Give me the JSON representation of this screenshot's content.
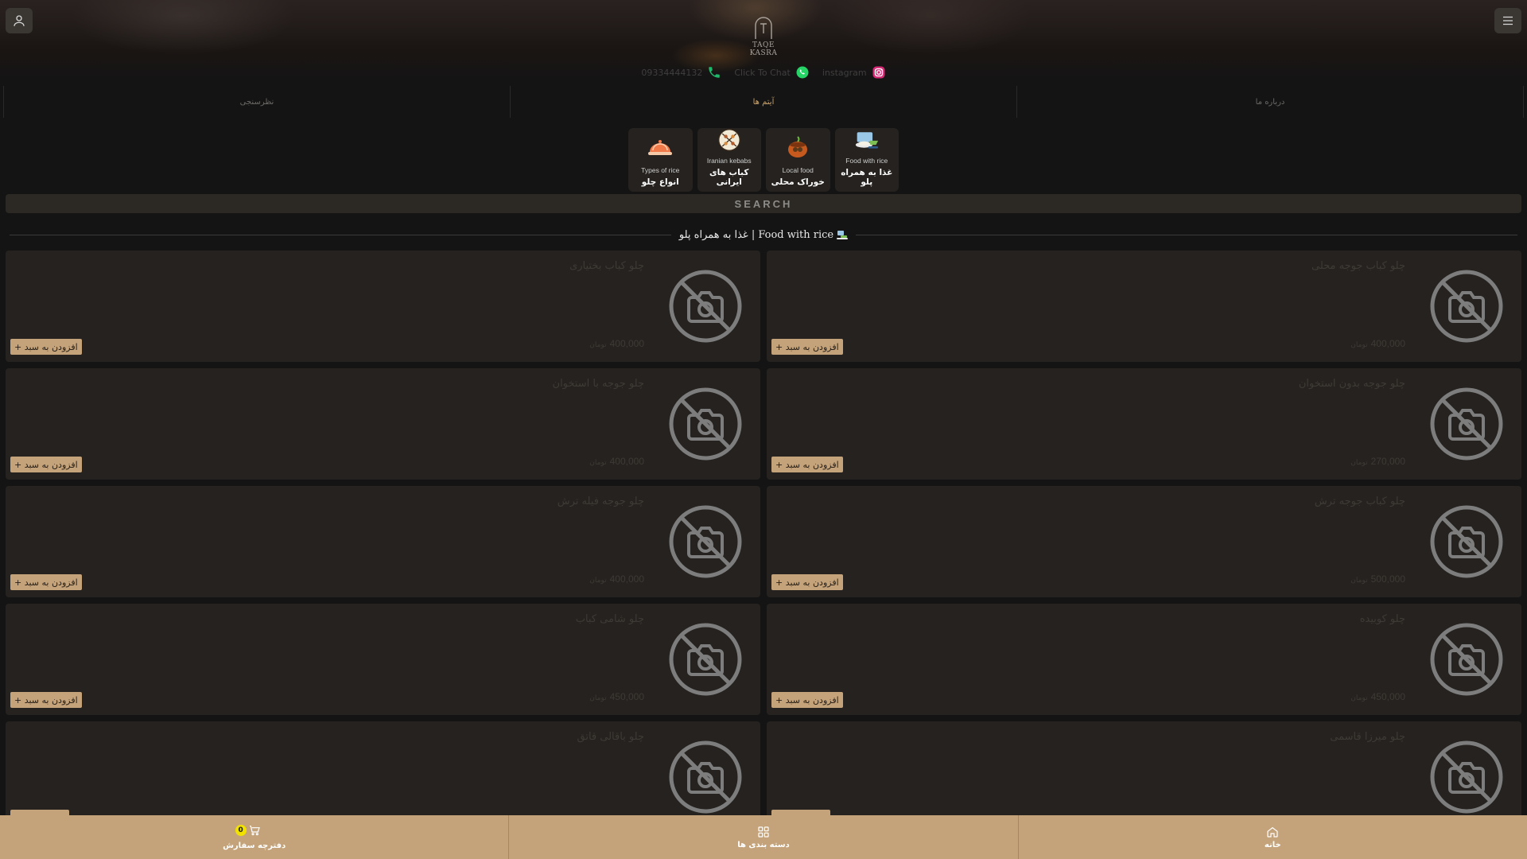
{
  "brand": {
    "name": "TAQE KASRA"
  },
  "contacts": {
    "phone": "09334444132",
    "chat": "Click To Chat",
    "instagram": "instagram"
  },
  "top_tabs": [
    {
      "label": "نظرسنجی",
      "active": false
    },
    {
      "label": "آیتم ها",
      "active": true
    },
    {
      "label": "درباره ما",
      "active": false
    }
  ],
  "categories": [
    {
      "en": "Food with rice",
      "fa": "غذا به همراه پلو",
      "icon": "plate-with-rice-icon"
    },
    {
      "en": "Local food",
      "fa": "خوراک محلی",
      "icon": "clay-pot-icon"
    },
    {
      "en": "Iranian kebabs",
      "fa": "کباب های ایرانی",
      "icon": "kebab-skewers-icon"
    },
    {
      "en": "Types of rice",
      "fa": "انواع چلو",
      "icon": "covered-dish-icon"
    }
  ],
  "search": {
    "label": "SEARCH"
  },
  "section": {
    "title": "غذا به همراه پلو | Food with rice"
  },
  "products": [
    {
      "name": "چلو کباب جوجه محلی",
      "price": "400,000",
      "unit": "تومان",
      "add_label": "افزودن به سبد +"
    },
    {
      "name": "چلو کباب بختیاری",
      "price": "400,000",
      "unit": "تومان",
      "add_label": "افزودن به سبد +"
    },
    {
      "name": "چلو جوجه بدون استخوان",
      "price": "270,000",
      "unit": "تومان",
      "add_label": "افزودن به سبد +"
    },
    {
      "name": "چلو جوجه با استخوان",
      "price": "400,000",
      "unit": "تومان",
      "add_label": "افزودن به سبد +"
    },
    {
      "name": "چلو کباب جوجه ترش",
      "price": "500,000",
      "unit": "تومان",
      "add_label": "افزودن به سبد +"
    },
    {
      "name": "چلو جوجه فیله ترش",
      "price": "400,000",
      "unit": "تومان",
      "add_label": "افزودن به سبد +"
    },
    {
      "name": "چلو کوبیده",
      "price": "450,000",
      "unit": "تومان",
      "add_label": "افزودن به سبد +"
    },
    {
      "name": "چلو شامی کباب",
      "price": "450,000",
      "unit": "تومان",
      "add_label": "افزودن به سبد +"
    },
    {
      "name": "چلو میرزا قاسمی",
      "price": "",
      "unit": "",
      "add_label": ""
    },
    {
      "name": "چلو باقالی قاتق",
      "price": "",
      "unit": "",
      "add_label": ""
    }
  ],
  "bottom_nav": [
    {
      "label": "دفترچه سفارش",
      "icon": "cart-icon",
      "badge": "0"
    },
    {
      "label": "دسته بندی ها",
      "icon": "grid-icon"
    },
    {
      "label": "خانه",
      "icon": "home-icon"
    }
  ],
  "colors": {
    "accent": "#c4a37a",
    "background": "#141414",
    "card": "#25221f",
    "badge": "#f2e200"
  }
}
